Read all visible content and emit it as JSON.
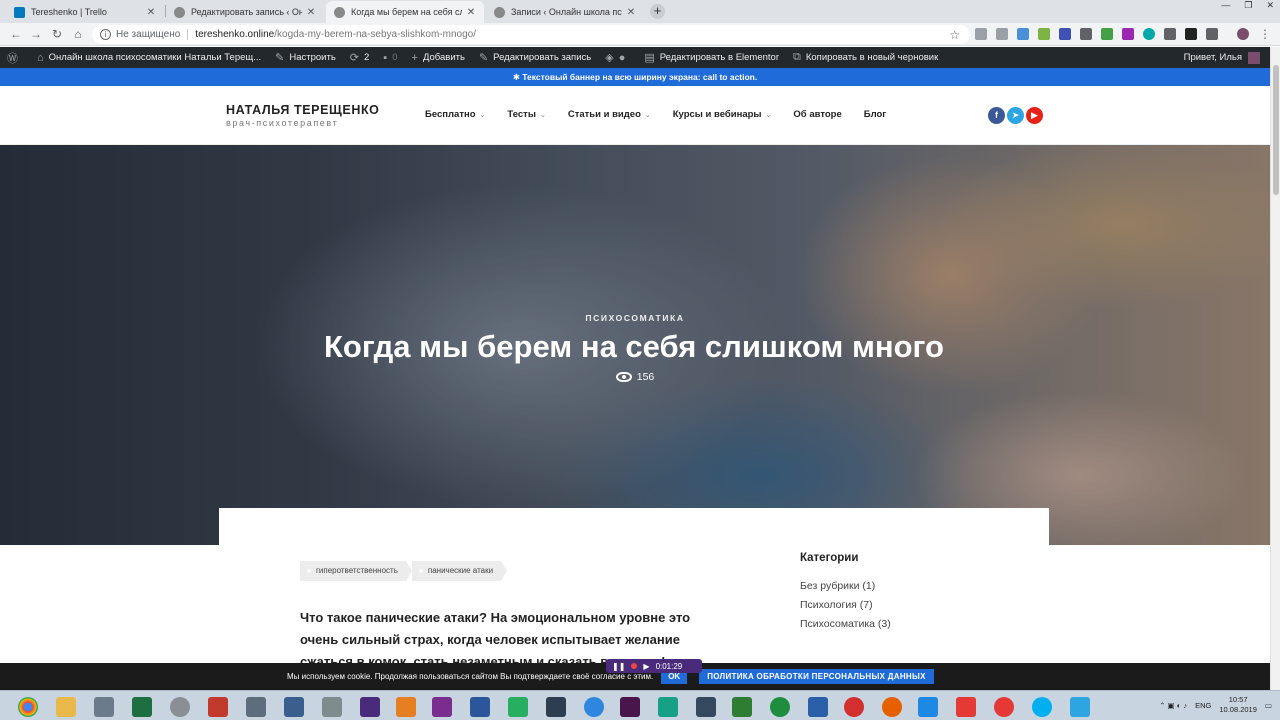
{
  "browser": {
    "tabs": [
      {
        "title": "Tereshenko | Trello",
        "color": "#0079bf",
        "active": false
      },
      {
        "title": "Редактировать запись ‹ Онлайн",
        "color": "#777777",
        "active": false
      },
      {
        "title": "Когда мы берем на себя слишк",
        "color": "#777777",
        "active": true
      },
      {
        "title": "Записи ‹ Онлайн школа психос",
        "color": "#777777",
        "active": false
      }
    ],
    "security_label": "Не защищено",
    "url_host": "tereshenko.online",
    "url_path": "/kogda-my-berem-na-sebya-slishkom-mnogo/"
  },
  "adminbar": {
    "site_name": "Онлайн школа психосоматики Натальи Терещ...",
    "customize": "Настроить",
    "updates": "2",
    "comments": "0",
    "add_new": "Добавить",
    "edit_post": "Редактировать запись",
    "edit_elementor": "Редактировать в Elementor",
    "copy_draft": "Копировать в новый черновик",
    "greeting": "Привет, Илья"
  },
  "site": {
    "banner": "✱ Текстовый баннер на всю ширину экрана: call to action.",
    "logo_name": "НАТАЛЬЯ ТЕРЕЩЕНКО",
    "logo_sub": "врач-психотерапевт",
    "nav": [
      {
        "label": "Бесплатно",
        "dropdown": true
      },
      {
        "label": "Тесты",
        "dropdown": true
      },
      {
        "label": "Статьи и видео",
        "dropdown": true
      },
      {
        "label": "Курсы и вебинары",
        "dropdown": true
      },
      {
        "label": "Об авторе",
        "dropdown": false
      },
      {
        "label": "Блог",
        "dropdown": false
      }
    ],
    "social_colors": {
      "facebook": "#3b5998",
      "telegram": "#2ca5e0",
      "youtube": "#e62117"
    }
  },
  "hero": {
    "category": "ПСИХОСОМАТИКА",
    "title": "Когда мы берем на себя слишком много",
    "views": "156"
  },
  "post": {
    "tags": [
      "гиперответственность",
      "панические атаки"
    ],
    "intro": "Что такое панические атаки? На эмоциональном уровне это очень сильный страх, когда человек испытывает желание сжаться в комок, стать незаметным и сказать всем: нет!"
  },
  "sidebar": {
    "title": "Категории",
    "categories": [
      {
        "label": "Без рубрики (1)"
      },
      {
        "label": "Психология (7)"
      },
      {
        "label": "Психосоматика (3)"
      }
    ]
  },
  "cookie": {
    "text": "Мы используем cookie. Продолжая пользоваться сайтом Вы подтверждаете своё согласие с этим.",
    "ok": "OK",
    "policy": "ПОЛИТИКА ОБРАБОТКИ ПЕРСОНАЛЬНЫХ ДАННЫХ"
  },
  "recorder": {
    "time": "0:01:29"
  },
  "taskbar": {
    "lang": "ENG",
    "time": "10:57",
    "date": "10.08.2019"
  }
}
